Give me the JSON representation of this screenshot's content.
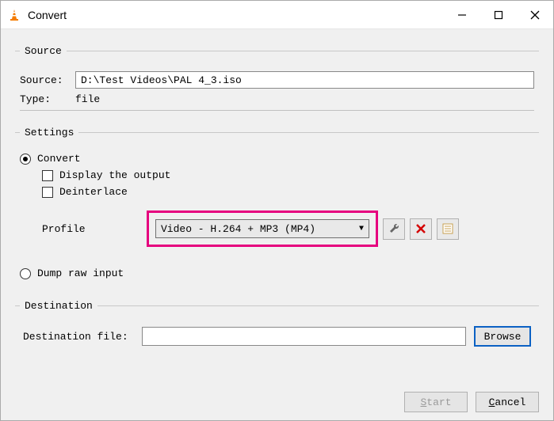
{
  "window": {
    "title": "Convert"
  },
  "source_group": {
    "legend": "Source",
    "source_label": "Source:",
    "source_value": "D:\\Test Videos\\PAL 4_3.iso",
    "type_label": "Type:",
    "type_value": "file"
  },
  "settings_group": {
    "legend": "Settings",
    "convert_label": "Convert",
    "display_output_label": "Display the output",
    "deinterlace_label": "Deinterlace",
    "profile_label": "Profile",
    "profile_value": "Video - H.264 + MP3 (MP4)",
    "dump_raw_label": "Dump raw input"
  },
  "destination_group": {
    "legend": "Destination",
    "dest_file_label": "Destination file:",
    "dest_file_value": "",
    "browse_label": "Browse"
  },
  "footer": {
    "start_label": "Start",
    "cancel_label": "Cancel"
  },
  "icons": {
    "wrench": "wrench-icon",
    "delete": "delete-icon",
    "new": "new-profile-icon"
  }
}
